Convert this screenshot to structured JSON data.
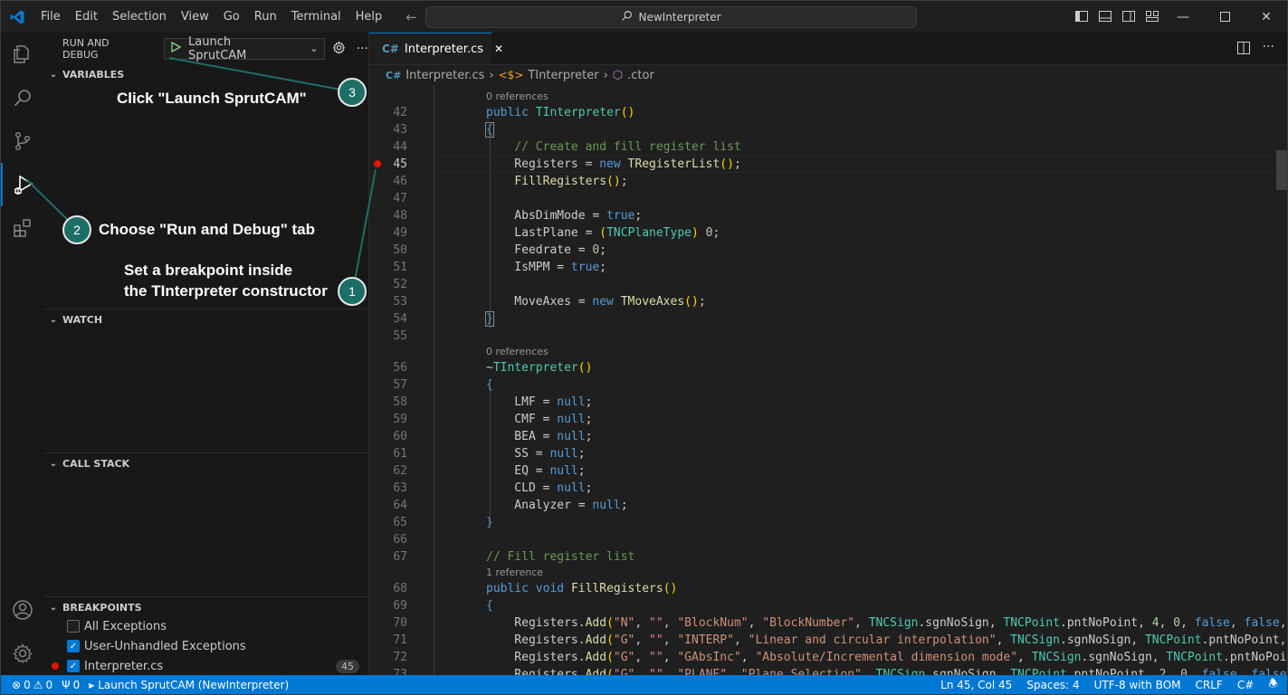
{
  "app": {
    "menu": [
      "File",
      "Edit",
      "Selection",
      "View",
      "Go",
      "Run",
      "Terminal",
      "Help"
    ],
    "search_text": "NewInterpreter"
  },
  "sidebar": {
    "title": "RUN AND DEBUG",
    "launch_config": "Launch SprutCAM",
    "sections": {
      "variables": "VARIABLES",
      "watch": "WATCH",
      "call_stack": "CALL STACK",
      "breakpoints": "BREAKPOINTS"
    },
    "breakpoints": [
      {
        "label": "All Exceptions",
        "checked": false
      },
      {
        "label": "User-Unhandled Exceptions",
        "checked": true
      },
      {
        "label": "Interpreter.cs",
        "checked": true,
        "line": "45"
      }
    ]
  },
  "editor": {
    "tab": "Interpreter.cs",
    "breadcrumb": [
      "Interpreter.cs",
      "TInterpreter",
      ".ctor"
    ],
    "lenses": [
      "0 references",
      "0 references",
      "1 reference"
    ]
  },
  "statusbar": {
    "errors": "0",
    "warnings": "0",
    "ports": "0",
    "debug": "Launch SprutCAM (NewInterpreter)",
    "position": "Ln 45, Col 45",
    "spaces": "Spaces: 4",
    "encoding": "UTF-8 with BOM",
    "eol": "CRLF",
    "language": "C#"
  },
  "annotations": {
    "step1": "Set a breakpoint inside",
    "step1b": "the TInterpreter constructor",
    "step2": "Choose \"Run and Debug\" tab",
    "step3": "Click \"Launch SprutCAM\"",
    "n1": "1",
    "n2": "2",
    "n3": "3"
  }
}
